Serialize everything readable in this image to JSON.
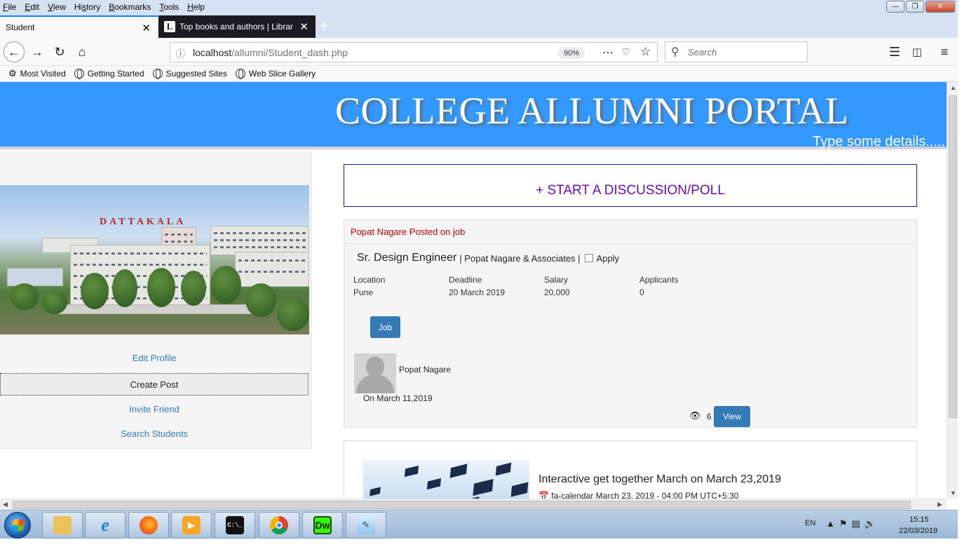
{
  "menu": [
    "File",
    "Edit",
    "View",
    "History",
    "Bookmarks",
    "Tools",
    "Help"
  ],
  "tabs": [
    {
      "label": "Student"
    },
    {
      "label": "Top books and authors | Librar",
      "favicon": "L"
    }
  ],
  "url": {
    "host": "localhost",
    "path": "/allumni/Student_dash.php",
    "zoom": "90%"
  },
  "search": {
    "placeholder": "Search"
  },
  "bookmarks": [
    "Most Visited",
    "Getting Started",
    "Suggested Sites",
    "Web Slice Gallery"
  ],
  "banner": {
    "title": "COLLEGE ALLUMNI PORTAL",
    "marquee": "Type some details....."
  },
  "campus_sign": "DATTAKALA",
  "sidebar": {
    "links": [
      "Edit Profile",
      "Create Post",
      "Invite Friend",
      "Search Students"
    ]
  },
  "discussion": {
    "label": "+ START A DISCUSSION/POLL"
  },
  "job_post": {
    "header": "Popat Nagare Posted on job",
    "title": "Sr. Design Engineer",
    "company": "| Popat Nagare & Associates |",
    "apply_label": "Apply",
    "meta": [
      {
        "label": "Location",
        "value": "Pune"
      },
      {
        "label": "Deadline",
        "value": "20 March 2019"
      },
      {
        "label": "Salary",
        "value": "20,000"
      },
      {
        "label": "Applicants",
        "value": "0"
      }
    ],
    "tag_button": "Job",
    "poster": "Popat Nagare",
    "date": "On March 11,2019",
    "views": "6",
    "view_button": "View"
  },
  "event_post": {
    "title": "Interactive get together March on March 23,2019",
    "date": "fa-calendar March 23, 2019 - 04:00 PM UTC+5:30"
  },
  "taskbar": {
    "lang": "EN",
    "time": "15:15",
    "date": "22/03/2019"
  },
  "colors": {
    "banner": "#3399ff",
    "button": "#337ab7",
    "discussion_text": "#6a0dad",
    "post_header": "#bb0000"
  }
}
